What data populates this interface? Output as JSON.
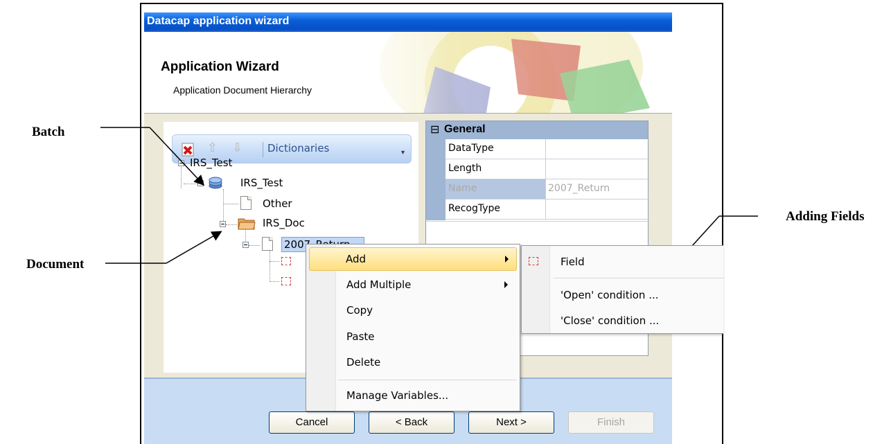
{
  "annotations": {
    "batch": "Batch",
    "document": "Document",
    "adding_fields": "Adding Fields"
  },
  "dialog": {
    "title": "Datacap application wizard",
    "banner_title": "Application Wizard",
    "banner_subtitle": "Application Document Hierarchy"
  },
  "toolbar": {
    "dictionaries_label": "Dictionaries",
    "delete_icon": "delete-icon",
    "up_icon": "arrow-up-icon",
    "down_icon": "arrow-down-icon"
  },
  "tree": {
    "root": "IRS_Test",
    "batch": "IRS_Test",
    "page_other": "Other",
    "document": "IRS_Doc",
    "page_selected": "2007_Return"
  },
  "properties": {
    "section": "General",
    "rows": [
      {
        "name": "DataType",
        "value": ""
      },
      {
        "name": "Length",
        "value": ""
      },
      {
        "name": "Name",
        "value": "2007_Return"
      },
      {
        "name": "RecogType",
        "value": ""
      }
    ]
  },
  "buttons": {
    "cancel": "Cancel",
    "back": "< Back",
    "next": "Next >",
    "finish": "Finish"
  },
  "context_menu": {
    "add": "Add",
    "add_multiple": "Add Multiple",
    "copy": "Copy",
    "paste": "Paste",
    "delete": "Delete",
    "manage_variables": "Manage Variables..."
  },
  "submenu": {
    "field": "Field",
    "open_condition": "'Open' condition ...",
    "close_condition": "'Close' condition ..."
  },
  "colors": {
    "titlebar": "#0a5fd8",
    "menu_highlight": "#ffdf7c",
    "selection": "#c1d8f6"
  }
}
